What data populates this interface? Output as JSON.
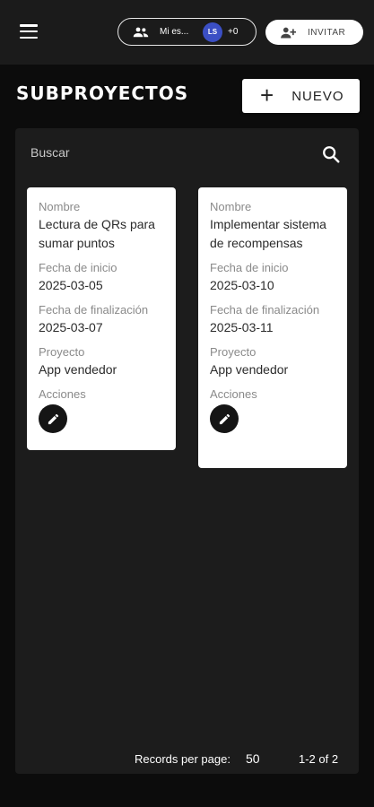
{
  "header": {
    "workspace_name": "Mi es...",
    "avatar_initials": "LS",
    "extra_members": "+0",
    "invite_label": "INVITAR"
  },
  "page": {
    "title": "SUBPROYECTOS",
    "new_button_label": "NUEVO"
  },
  "search": {
    "placeholder": "Buscar"
  },
  "labels": {
    "name": "Nombre",
    "start_date": "Fecha de inicio",
    "end_date": "Fecha de finalización",
    "project": "Proyecto",
    "actions": "Acciones"
  },
  "cards": [
    {
      "name": "Lectura de QRs para sumar puntos",
      "start_date": "2025-03-05",
      "end_date": "2025-03-07",
      "project": "App vendedor"
    },
    {
      "name": "Implementar sistema de recompensas",
      "start_date": "2025-03-10",
      "end_date": "2025-03-11",
      "project": "App vendedor"
    }
  ],
  "pagination": {
    "records_label": "Records per page:",
    "per_page": "50",
    "range": "1-2 of 2"
  },
  "icons": {
    "menu": "hamburger-menu-icon",
    "group": "group-icon",
    "invite": "person-add-icon",
    "add": "plus-icon",
    "search": "search-icon",
    "edit": "pencil-icon"
  },
  "colors": {
    "background": "#0c0c0c",
    "topbar": "#1b1b1b",
    "panel": "#1c1c1c",
    "avatar": "#3b4fc4",
    "card": "#ffffff"
  }
}
